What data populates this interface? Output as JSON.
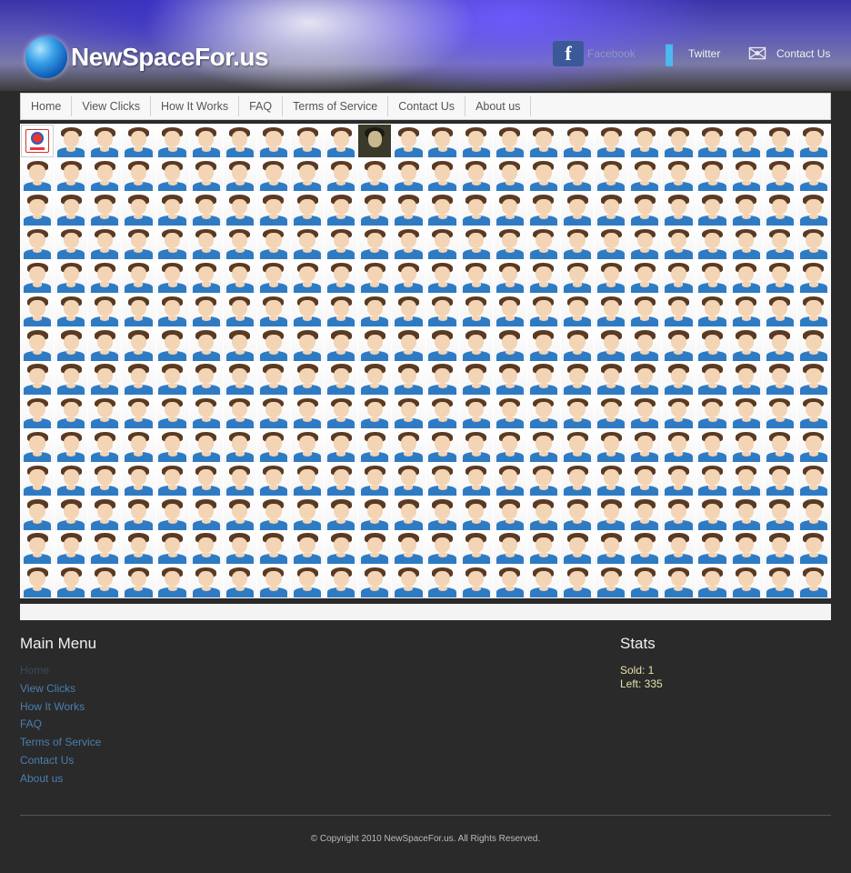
{
  "header": {
    "site_name": "NewSpaceFor.us",
    "social": {
      "facebook_label": "Facebook",
      "twitter_label": "Twitter",
      "contact_label": "Contact Us"
    }
  },
  "nav": {
    "items": [
      {
        "label": "Home"
      },
      {
        "label": "View Clicks"
      },
      {
        "label": "How It Works"
      },
      {
        "label": "FAQ"
      },
      {
        "label": "Terms of Service"
      },
      {
        "label": "Contact Us"
      },
      {
        "label": "About us"
      }
    ]
  },
  "grid": {
    "columns": 24,
    "rows": 14,
    "sold_slots": [
      {
        "index": 0,
        "kind": "logo-ad"
      },
      {
        "index": 10,
        "kind": "photo"
      }
    ]
  },
  "footer": {
    "menu_title": "Main Menu",
    "menu_items": [
      {
        "label": "Home",
        "active": true
      },
      {
        "label": "View Clicks"
      },
      {
        "label": "How It Works"
      },
      {
        "label": "FAQ"
      },
      {
        "label": "Terms of Service"
      },
      {
        "label": "Contact Us"
      },
      {
        "label": "About us"
      }
    ],
    "stats_title": "Stats",
    "sold": "Sold: 1",
    "left": "Left: 335",
    "copyright": "© Copyright 2010 NewSpaceFor.us. All Rights Reserved."
  }
}
